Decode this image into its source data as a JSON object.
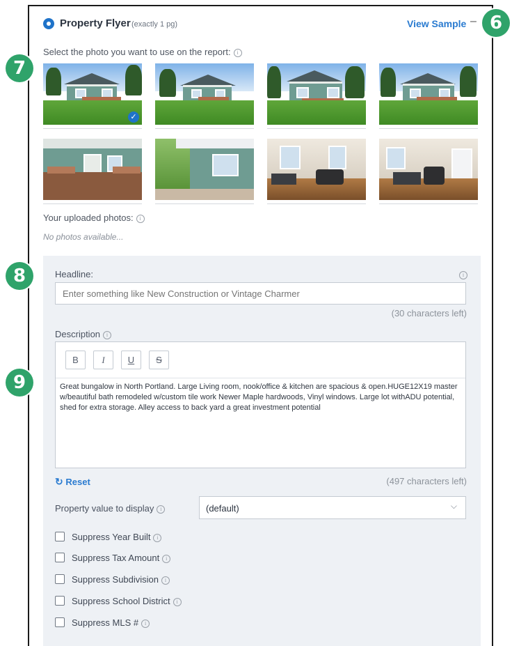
{
  "header": {
    "title": "Property Flyer",
    "subtitle": "(exactly 1 pg)",
    "view_sample": "View Sample",
    "collapse": "–"
  },
  "photos": {
    "prompt": "Select the photo you want to use on the report:",
    "selected_index": 0,
    "items": [
      {
        "kind": "exterior",
        "selected": true
      },
      {
        "kind": "exterior",
        "selected": false
      },
      {
        "kind": "exterior",
        "selected": false
      },
      {
        "kind": "exterior",
        "selected": false
      },
      {
        "kind": "porch",
        "selected": false
      },
      {
        "kind": "porch",
        "selected": false
      },
      {
        "kind": "interior",
        "selected": false
      },
      {
        "kind": "interior",
        "selected": false
      }
    ],
    "uploaded_label": "Your uploaded photos:",
    "no_photos": "No photos available..."
  },
  "form": {
    "headline_label": "Headline:",
    "headline_value": "",
    "headline_placeholder": "Enter something like New Construction or Vintage Charmer",
    "headline_counter": "(30 characters left)",
    "description_label": "Description",
    "toolbar": {
      "bold": "B",
      "italic": "I",
      "underline": "U",
      "strike": "S"
    },
    "description_text": "Great bungalow in North Portland. Large Living room, nook/office & kitchen are spacious & open.HUGE12X19 master w/beautiful bath remodeled w/custom tile work Newer Maple hardwoods, Vinyl windows. Large lot withADU potential, shed for extra storage. Alley access to back yard a great investment potential",
    "description_counter": "(497 characters left)",
    "reset_label": "Reset",
    "property_value_label": "Property value to display",
    "property_value_selected": "(default)",
    "checkboxes": [
      {
        "label": "Suppress Year Built",
        "checked": false
      },
      {
        "label": "Suppress Tax Amount",
        "checked": false
      },
      {
        "label": "Suppress Subdivision",
        "checked": false
      },
      {
        "label": "Suppress School District",
        "checked": false
      },
      {
        "label": "Suppress MLS #",
        "checked": false
      }
    ]
  },
  "callouts": [
    "6",
    "7",
    "8",
    "9"
  ],
  "colors": {
    "accent": "#1f73c9",
    "link": "#2a7bd0",
    "callout": "#2fa36a",
    "form_bg": "#eef1f5"
  },
  "icons": {
    "info": "info-icon",
    "reset": "refresh-icon",
    "dropdown": "chevron-down-icon",
    "selected": "check-icon"
  }
}
